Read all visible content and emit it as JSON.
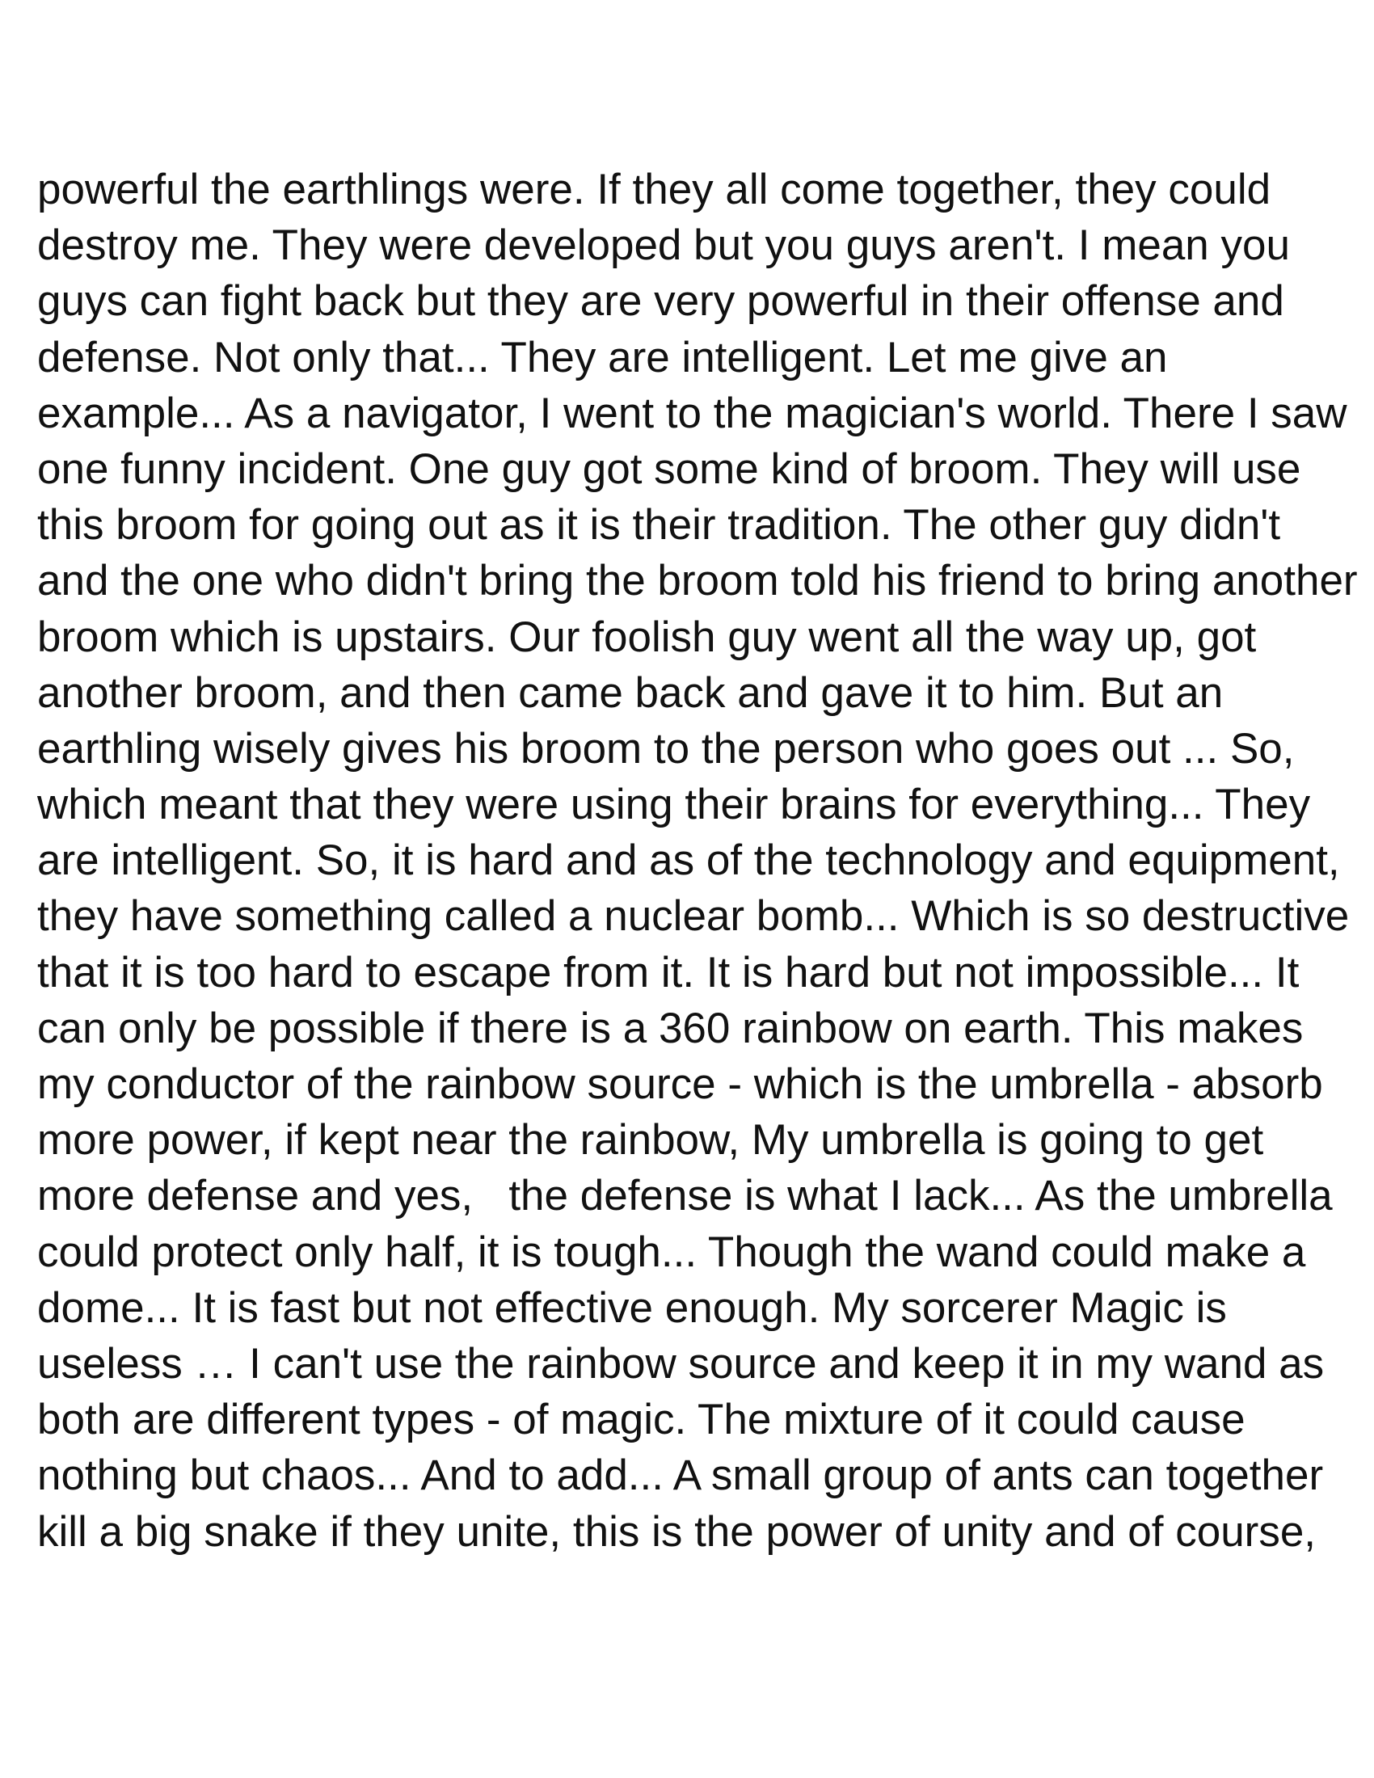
{
  "document": {
    "lines": [
      "powerful the earthlings were. If they all come together, they could",
      "destroy me. They were developed but you guys aren't. I mean you",
      "guys can fight back but they are very powerful in their offense and",
      "defense. Not only that... They are intelligent. Let me give an",
      "example... As a navigator, I went to the magician's world. There I saw",
      "one funny incident. One guy got some kind of broom. They will use",
      "this broom for going out as it is their tradition. The other guy didn't",
      "and the one who didn't bring the broom told his friend to bring another",
      "broom which is upstairs. Our foolish guy went all the way up, got",
      "another broom, and then came back and gave it to him. But an",
      "earthling wisely gives his broom to the person who goes out ... So,",
      "which meant that they were using their brains for everything... They",
      "are intelligent. So, it is hard and as of the technology and equipment,",
      "they have something called a nuclear bomb... Which is so destructive",
      "that it is too hard to escape from it. It is hard but not impossible... It",
      "can only be possible if there is a 360 rainbow on earth. This makes",
      "my conductor of the rainbow source - which is the umbrella - absorb",
      "more power, if kept near the rainbow, My umbrella is going to get",
      "more defense and yes,   the defense is what I lack... As the umbrella",
      "could protect only half, it is tough... Though the wand could make a",
      "dome... It is fast but not effective enough. My sorcerer Magic is",
      "useless … I can't use the rainbow source and keep it in my wand as",
      "both are different types - of magic. The mixture of it could cause",
      "nothing but chaos... And to add... A small group of ants can together",
      "kill a big snake if they unite, this is the power of unity and of course,"
    ]
  }
}
